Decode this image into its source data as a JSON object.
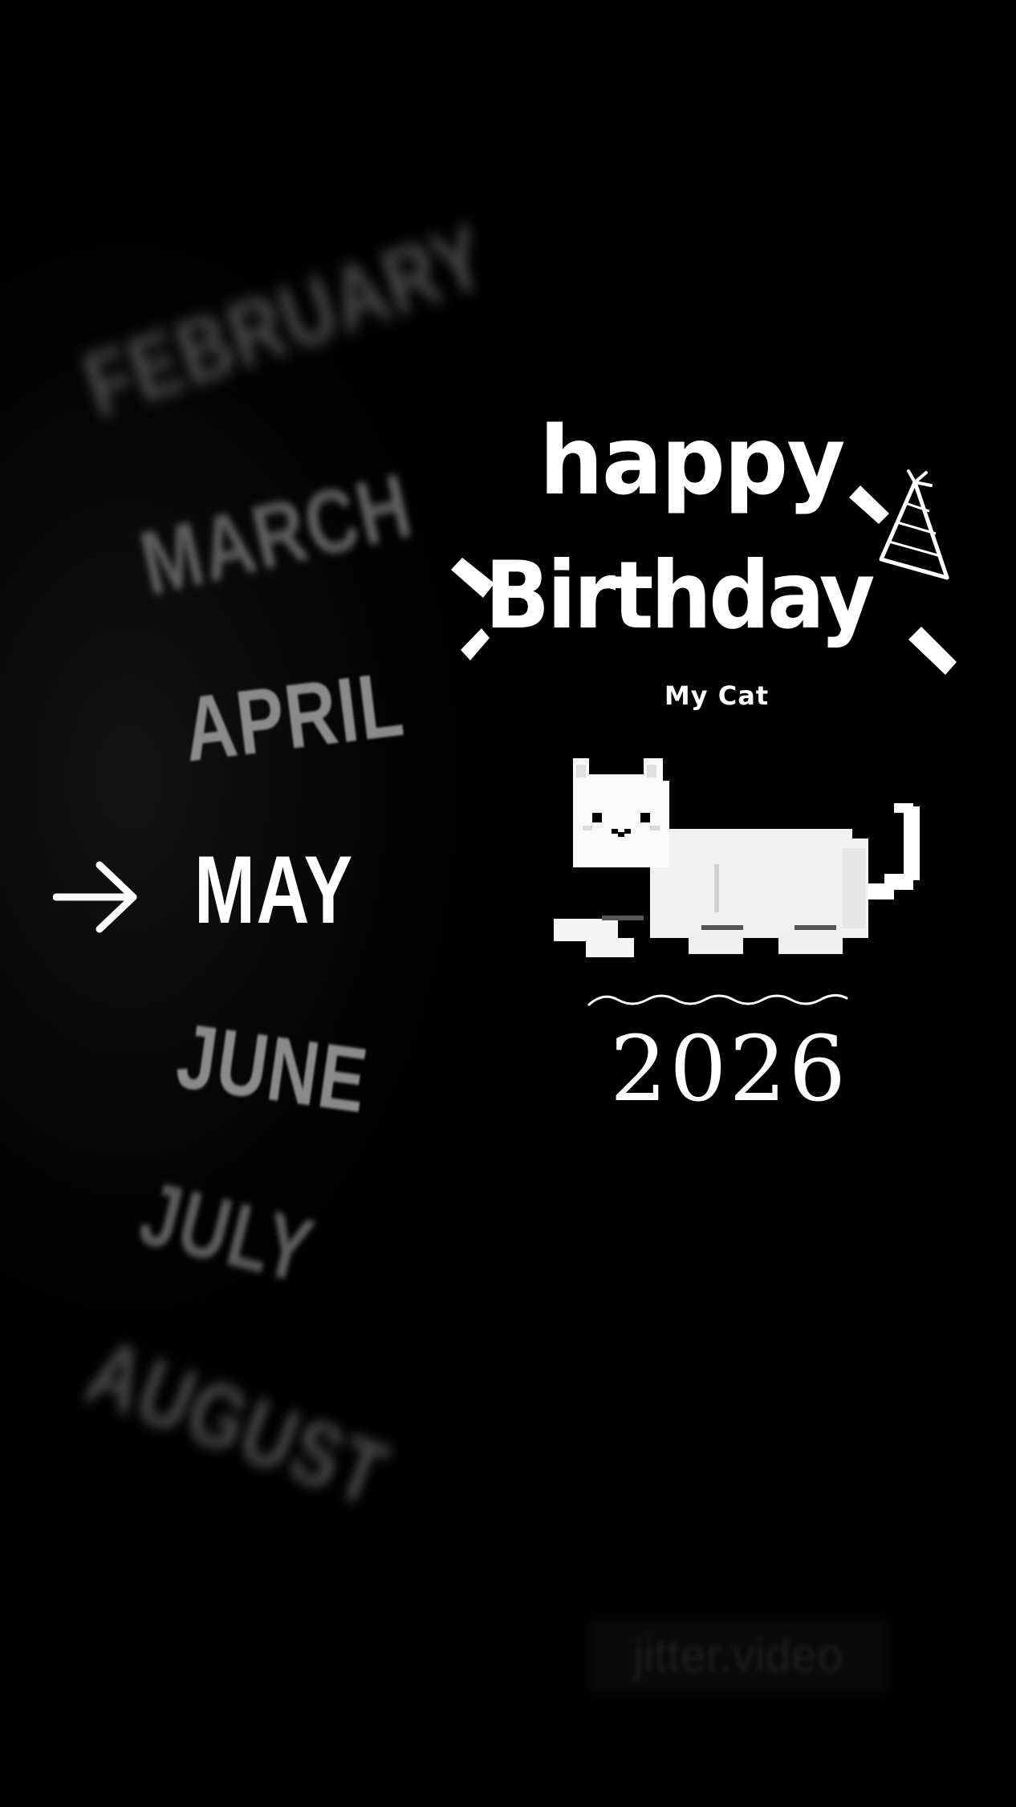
{
  "months": {
    "jan": "",
    "feb": "FEBRUARY",
    "mar": "MARCH",
    "apr": "APRIL",
    "may": "MAY",
    "jun": "JUNE",
    "jul": "JULY",
    "aug": "AUGUST",
    "sep": ""
  },
  "selected_month_icon": "arrow-right-icon",
  "title": {
    "line1": "happy",
    "line2": "Birthday",
    "subtitle": "My Cat"
  },
  "decorations": {
    "hat_icon": "party-hat-icon",
    "cat_image": "pixel-cat-icon"
  },
  "year": "2026",
  "watermark": "jitter.video",
  "colors": {
    "background": "#000000",
    "foreground": "#ffffff"
  }
}
